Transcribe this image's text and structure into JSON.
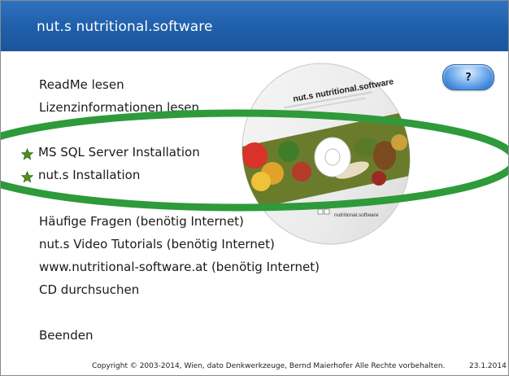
{
  "app": {
    "title": "nut.s nutritional.software"
  },
  "help_button": {
    "label": "?"
  },
  "menu": {
    "readme": "ReadMe lesen",
    "license": "Lizenzinformationen lesen",
    "mssql": "MS SQL Server Installation",
    "nuts_install": "nut.s Installation",
    "faq": "Häufige Fragen (benötig Internet)",
    "tutorials": "nut.s Video Tutorials (benötig Internet)",
    "website": "www.nutritional-software.at (benötig Internet)",
    "browse_cd": "CD durchsuchen",
    "exit": "Beenden"
  },
  "cd": {
    "title": "nut.s nutritional.software",
    "logo_text": "nutritional.software"
  },
  "footer": {
    "copyright": "Copyright © 2003-2014, Wien, dato Denkwerkzeuge, Bernd Maierhofer Alle Rechte vorbehalten.",
    "date": "23.1.2014"
  },
  "colors": {
    "titlebar": "#1f5ea9",
    "highlight_ellipse": "#2e9a3a",
    "star": "#4f8f1e"
  }
}
